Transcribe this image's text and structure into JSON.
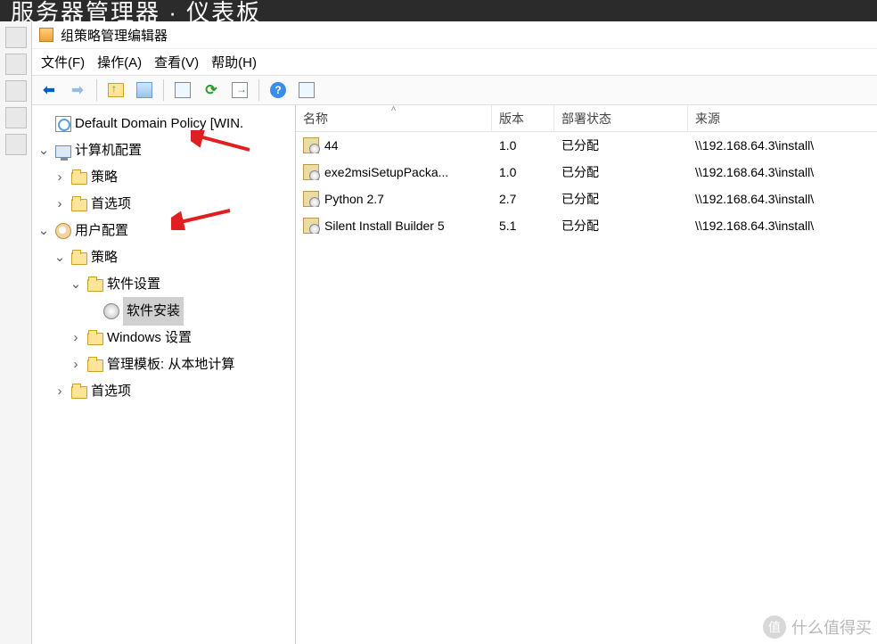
{
  "topbar_fragment": "服务器管理器 · 仪表板",
  "window_title": "组策略管理编辑器",
  "menus": {
    "file": "文件(F)",
    "action": "操作(A)",
    "view": "查看(V)",
    "help": "帮助(H)"
  },
  "tree": {
    "root": "Default Domain Policy [WIN.",
    "computer_config": "计算机配置",
    "policies": "策略",
    "preferences": "首选项",
    "user_config": "用户配置",
    "software_settings": "软件设置",
    "software_install": "软件安装",
    "windows_settings": "Windows 设置",
    "admin_templates": "管理模板: 从本地计算"
  },
  "columns": {
    "name": "名称",
    "version": "版本",
    "deploy_status": "部署状态",
    "source": "来源"
  },
  "rows": [
    {
      "name": "44",
      "version": "1.0",
      "status": "已分配",
      "source": "\\\\192.168.64.3\\install\\"
    },
    {
      "name": "exe2msiSetupPacka...",
      "version": "1.0",
      "status": "已分配",
      "source": "\\\\192.168.64.3\\install\\"
    },
    {
      "name": "Python 2.7",
      "version": "2.7",
      "status": "已分配",
      "source": "\\\\192.168.64.3\\install\\"
    },
    {
      "name": "Silent Install Builder 5",
      "version": "5.1",
      "status": "已分配",
      "source": "\\\\192.168.64.3\\install\\"
    }
  ],
  "watermark": "什么值得买"
}
